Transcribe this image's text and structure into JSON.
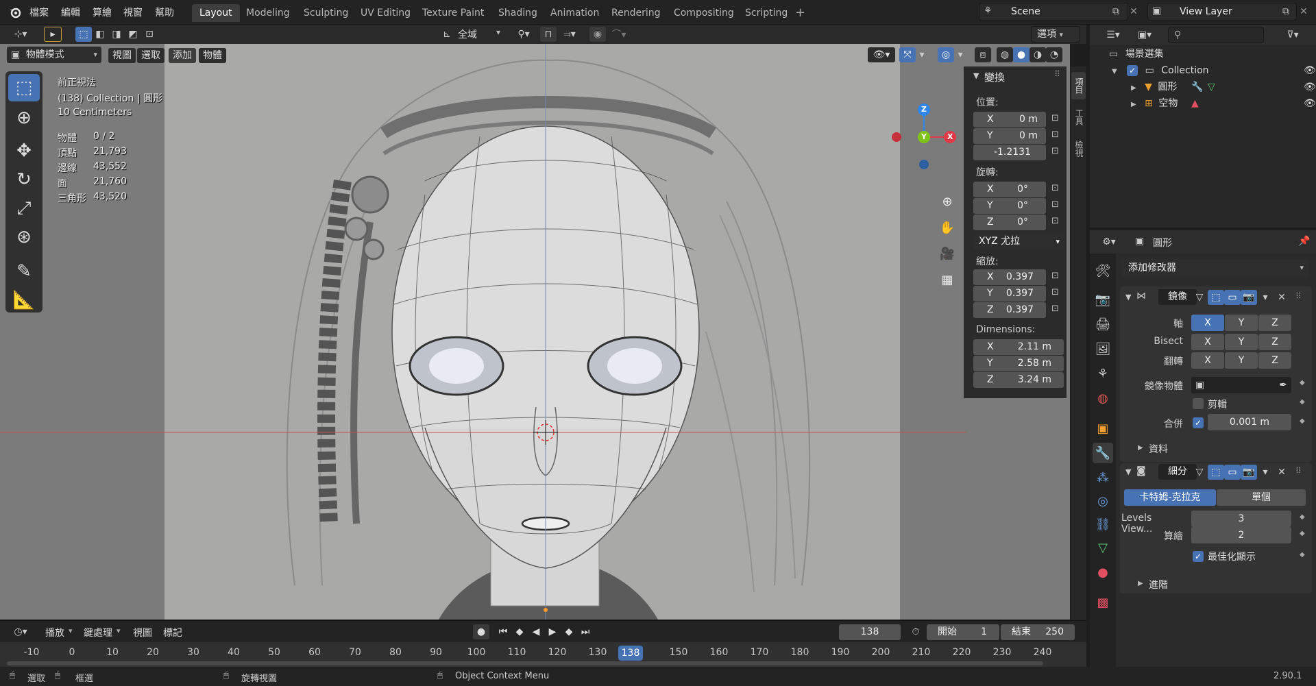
{
  "menus": [
    "檔案",
    "編輯",
    "算繪",
    "視窗",
    "幫助"
  ],
  "workspaces": [
    "Layout",
    "Modeling",
    "Sculpting",
    "UV Editing",
    "Texture Paint",
    "Shading",
    "Animation",
    "Rendering",
    "Compositing",
    "Scripting"
  ],
  "active_workspace": "Layout",
  "scene": "Scene",
  "view_layer": "View Layer",
  "viewport_header": {
    "transform_space": "全域",
    "options": "選項",
    "mode": "物體模式",
    "menu": [
      "視圖",
      "選取",
      "添加",
      "物體"
    ]
  },
  "overlay": {
    "view_name": "前正視法",
    "collection_line": "(138) Collection | 圓形",
    "grid_scale": "10 Centimeters",
    "stats": [
      {
        "label": "物體",
        "value": "0 / 2"
      },
      {
        "label": "頂點",
        "value": "21,793"
      },
      {
        "label": "邊線",
        "value": "43,552"
      },
      {
        "label": "面",
        "value": "21,760"
      },
      {
        "label": "三角形",
        "value": "43,520"
      }
    ]
  },
  "gizmo": {
    "x": "X",
    "y": "Y",
    "z": "Z"
  },
  "npanel": {
    "title": "變換",
    "location_label": "位置:",
    "location": [
      {
        "axis": "X",
        "value": "0 m"
      },
      {
        "axis": "Y",
        "value": "0 m"
      },
      {
        "axis": "",
        "value": "-1.2131"
      }
    ],
    "rotation_label": "旋轉:",
    "rotation": [
      {
        "axis": "X",
        "value": "0°"
      },
      {
        "axis": "Y",
        "value": "0°"
      },
      {
        "axis": "Z",
        "value": "0°"
      }
    ],
    "rotation_mode": "XYZ 尤拉",
    "scale_label": "縮放:",
    "scale": [
      {
        "axis": "X",
        "value": "0.397"
      },
      {
        "axis": "Y",
        "value": "0.397"
      },
      {
        "axis": "Z",
        "value": "0.397"
      }
    ],
    "dimensions_label": "Dimensions:",
    "dimensions": [
      {
        "axis": "X",
        "value": "2.11 m"
      },
      {
        "axis": "Y",
        "value": "2.58 m"
      },
      {
        "axis": "Z",
        "value": "3.24 m"
      }
    ],
    "side_tabs": [
      "項目",
      "工具",
      "檢視"
    ]
  },
  "timeline": {
    "menus": [
      "播放",
      "鍵處理",
      "視圖",
      "標記"
    ],
    "current_frame": "138",
    "start_label": "開始",
    "start": "1",
    "end_label": "結束",
    "end": "250",
    "ticks": [
      "-10",
      "0",
      "10",
      "20",
      "30",
      "40",
      "50",
      "60",
      "70",
      "80",
      "90",
      "100",
      "110",
      "120",
      "130",
      "138",
      "150",
      "160",
      "170",
      "180",
      "190",
      "200",
      "210",
      "220",
      "230",
      "240"
    ]
  },
  "statusbar": {
    "select": "選取",
    "box_select": "框選",
    "rotate_view": "旋轉視圖",
    "context_menu": "Object Context Menu",
    "version": "2.90.1"
  },
  "outliner": {
    "root": "場景選集",
    "collection": "Collection",
    "items": [
      "圓形",
      "空物"
    ]
  },
  "properties": {
    "object_name": "圓形",
    "add_modifier": "添加修改器",
    "mirror": {
      "name": "鏡像",
      "axis_label": "軸",
      "bisect_label": "Bisect",
      "flip_label": "翻轉",
      "axes": [
        "X",
        "Y",
        "Z"
      ],
      "mirror_object_label": "鏡像物體",
      "clipping_label": "剪輯",
      "merge_label": "合併",
      "merge_value": "0.001 m",
      "data_label": "資料"
    },
    "subsurf": {
      "name": "細分",
      "type_catmull": "卡特姆-克拉克",
      "type_simple": "單個",
      "levels_viewport_label": "Levels View...",
      "levels_viewport": "3",
      "render_label": "算繪",
      "render": "2",
      "optimal_label": "最佳化顯示",
      "advanced_label": "進階"
    }
  },
  "colors": {
    "accent": "#4772b3",
    "x_axis": "#e03a47",
    "y_axis": "#80c41b",
    "z_axis": "#2f86e8"
  }
}
